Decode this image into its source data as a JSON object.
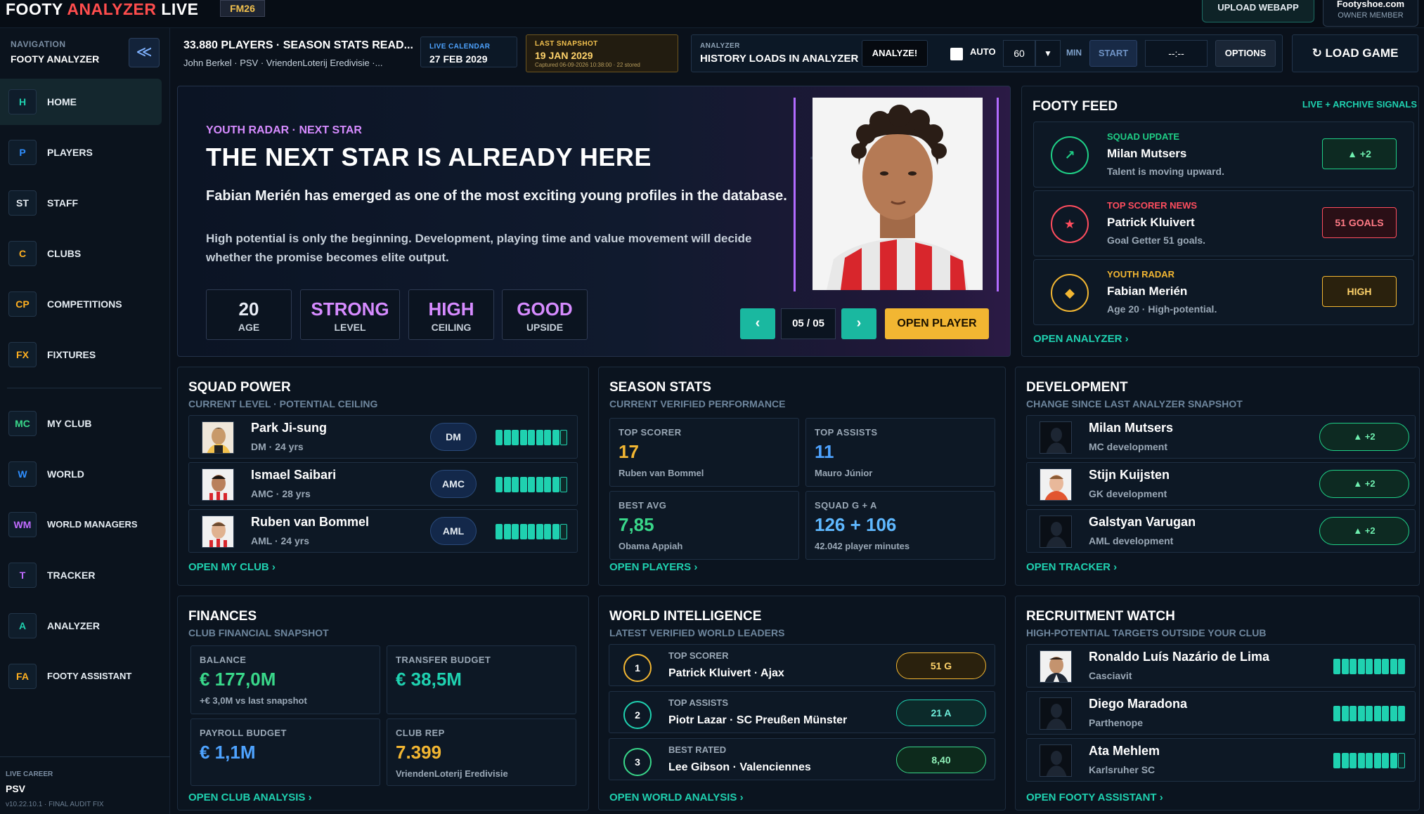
{
  "topbar": {
    "brand_main": "FOOTY",
    "brand_accent": "ANALYZER",
    "brand_tail": "LIVE",
    "version_badge": "FM26",
    "upload_label": "UPLOAD WEBAPP",
    "owner_site": "Footyshoe.com",
    "owner_role": "OWNER MEMBER"
  },
  "sidebar": {
    "caption": "NAVIGATION",
    "app_name": "FOOTY ANALYZER",
    "collapse_glyph": "≪",
    "items": [
      {
        "code": "H",
        "label": "HOME"
      },
      {
        "code": "P",
        "label": "PLAYERS"
      },
      {
        "code": "ST",
        "label": "STAFF"
      },
      {
        "code": "C",
        "label": "CLUBS"
      },
      {
        "code": "CP",
        "label": "COMPETITIONS"
      },
      {
        "code": "FX",
        "label": "FIXTURES"
      },
      {
        "code": "MC",
        "label": "MY CLUB"
      },
      {
        "code": "W",
        "label": "WORLD"
      },
      {
        "code": "WM",
        "label": "WORLD MANAGERS"
      },
      {
        "code": "T",
        "label": "TRACKER"
      },
      {
        "code": "A",
        "label": "ANALYZER"
      },
      {
        "code": "FA",
        "label": "FOOTY ASSISTANT"
      }
    ],
    "career_caption": "LIVE CAREER",
    "career_club": "PSV",
    "career_version": "v10.22.10.1 · FINAL AUDIT FIX"
  },
  "header": {
    "title": "33.880 PLAYERS · SEASON STATS READ...",
    "subtitle": "John Berkel  ·  PSV  ·  VriendenLoterij Eredivisie  ·...",
    "calendar_caption": "LIVE CALENDAR",
    "calendar_value": "27 FEB 2029",
    "snapshot_caption": "LAST SNAPSHOT",
    "snapshot_value": "19 JAN 2029",
    "snapshot_detail": "Captured 06-09-2026 10:38:00 · 22 stored",
    "analyzer_caption": "ANALYZER",
    "analyzer_value": "HISTORY LOADS IN ANALYZER",
    "analyze_label": "ANALYZE!",
    "auto_label": "AUTO",
    "minutes_value": "60",
    "minutes_arrow": "▼",
    "minutes_label": "MIN",
    "start_label": "START",
    "timer_value": "--:--",
    "options_label": "OPTIONS",
    "load_game_label": "↻  LOAD GAME"
  },
  "hero": {
    "kicker": "YOUTH RADAR · NEXT STAR",
    "title": "THE NEXT STAR IS ALREADY HERE",
    "lead": "Fabian Merién has emerged as one of the most exciting young profiles in the database.",
    "body": "High potential is only the beginning. Development, playing time and value movement will decide whether the promise becomes elite output.",
    "stats": [
      {
        "value": "20",
        "label": "AGE"
      },
      {
        "value": "STRONG",
        "label": "LEVEL"
      },
      {
        "value": "HIGH",
        "label": "CEILING"
      },
      {
        "value": "GOOD",
        "label": "UPSIDE"
      }
    ],
    "prev_glyph": "‹",
    "next_glyph": "›",
    "counter": "05 / 05",
    "open_label": "OPEN PLAYER"
  },
  "feed": {
    "title": "FOOTY FEED",
    "tag": "LIVE + ARCHIVE SIGNALS",
    "items": [
      {
        "caption": "SQUAD UPDATE",
        "name": "Milan Mutsers",
        "desc": "Talent is moving upward.",
        "pill": "▲ +2",
        "glyph": "↗",
        "color": "#1fcf86"
      },
      {
        "caption": "TOP SCORER NEWS",
        "name": "Patrick Kluivert",
        "desc": "Goal Getter 51 goals.",
        "pill": "51 GOALS",
        "glyph": "★",
        "color": "#ff4d5e"
      },
      {
        "caption": "YOUTH RADAR",
        "name": "Fabian Merién",
        "desc": "Age 20 · High-potential.",
        "pill": "HIGH",
        "glyph": "◆",
        "color": "#f2b632"
      }
    ],
    "link": "OPEN ANALYZER  ›"
  },
  "squad": {
    "title": "SQUAD POWER",
    "subtitle": "CURRENT LEVEL · POTENTIAL CEILING",
    "rows": [
      {
        "name": "Park Ji-sung",
        "sub": "DM · 24 yrs",
        "pos": "DM",
        "level": 8
      },
      {
        "name": "Ismael Saibari",
        "sub": "AMC · 28 yrs",
        "pos": "AMC",
        "level": 8
      },
      {
        "name": "Ruben van Bommel",
        "sub": "AML · 24 yrs",
        "pos": "AML",
        "level": 8
      }
    ],
    "link": "OPEN MY CLUB  ›"
  },
  "season": {
    "title": "SEASON STATS",
    "subtitle": "CURRENT VERIFIED PERFORMANCE",
    "tiles": [
      {
        "cap": "TOP SCORER",
        "big": "17",
        "foot": "Ruben van Bommel",
        "color": "#f2b632"
      },
      {
        "cap": "TOP ASSISTS",
        "big": "11",
        "foot": "Mauro Júnior",
        "color": "#4ea3ff"
      },
      {
        "cap": "BEST AVG",
        "big": "7,85",
        "foot": "Obama Appiah",
        "color": "#39d78a"
      },
      {
        "cap": "SQUAD G + A",
        "big": "126 + 106",
        "foot": "42.042 player minutes",
        "color": "#5fb8ff"
      }
    ],
    "link": "OPEN PLAYERS  ›"
  },
  "development": {
    "title": "DEVELOPMENT",
    "subtitle": "CHANGE SINCE LAST ANALYZER SNAPSHOT",
    "rows": [
      {
        "name": "Milan Mutsers",
        "sub": "MC development",
        "delta": "▲ +2"
      },
      {
        "name": "Stijn Kuijsten",
        "sub": "GK development",
        "delta": "▲ +2"
      },
      {
        "name": "Galstyan Varugan",
        "sub": "AML development",
        "delta": "▲ +2"
      }
    ],
    "link": "OPEN TRACKER  ›"
  },
  "finances": {
    "title": "FINANCES",
    "subtitle": "CLUB FINANCIAL SNAPSHOT",
    "tiles": [
      {
        "cap": "BALANCE",
        "big": "€ 177,0M",
        "foot": "+€ 3,0M vs last snapshot",
        "color": "#39d78a"
      },
      {
        "cap": "TRANSFER BUDGET",
        "big": "€ 38,5M",
        "foot": "",
        "color": "#1fd1b0"
      },
      {
        "cap": "PAYROLL BUDGET",
        "big": "€ 1,1M",
        "foot": "",
        "color": "#4ea3ff"
      },
      {
        "cap": "CLUB REP",
        "big": "7.399",
        "foot": "VriendenLoterij Eredivisie",
        "color": "#f2b632"
      }
    ],
    "link": "OPEN CLUB ANALYSIS  ›"
  },
  "world": {
    "title": "WORLD INTELLIGENCE",
    "subtitle": "LATEST VERIFIED WORLD LEADERS",
    "rows": [
      {
        "num": "1",
        "cap": "TOP SCORER",
        "name": "Patrick Kluivert · Ajax",
        "pill": "51 G",
        "color": "#f2b632"
      },
      {
        "num": "2",
        "cap": "TOP ASSISTS",
        "name": "Piotr Lazar · SC Preußen Münster",
        "pill": "21 A",
        "color": "#1fd1b0"
      },
      {
        "num": "3",
        "cap": "BEST RATED",
        "name": "Lee Gibson · Valenciennes",
        "pill": "8,40",
        "color": "#39d78a"
      }
    ],
    "link": "OPEN WORLD ANALYSIS  ›"
  },
  "recruitment": {
    "title": "RECRUITMENT WATCH",
    "subtitle": "HIGH-POTENTIAL TARGETS OUTSIDE YOUR CLUB",
    "rows": [
      {
        "name": "Ronaldo Luís Nazário de Lima",
        "sub": "Casciavit",
        "level": 9
      },
      {
        "name": "Diego Maradona",
        "sub": "Parthenope",
        "level": 9
      },
      {
        "name": "Ata Mehlem",
        "sub": "Karlsruher SC",
        "level": 8
      }
    ],
    "link": "OPEN FOOTY ASSISTANT  ›"
  }
}
